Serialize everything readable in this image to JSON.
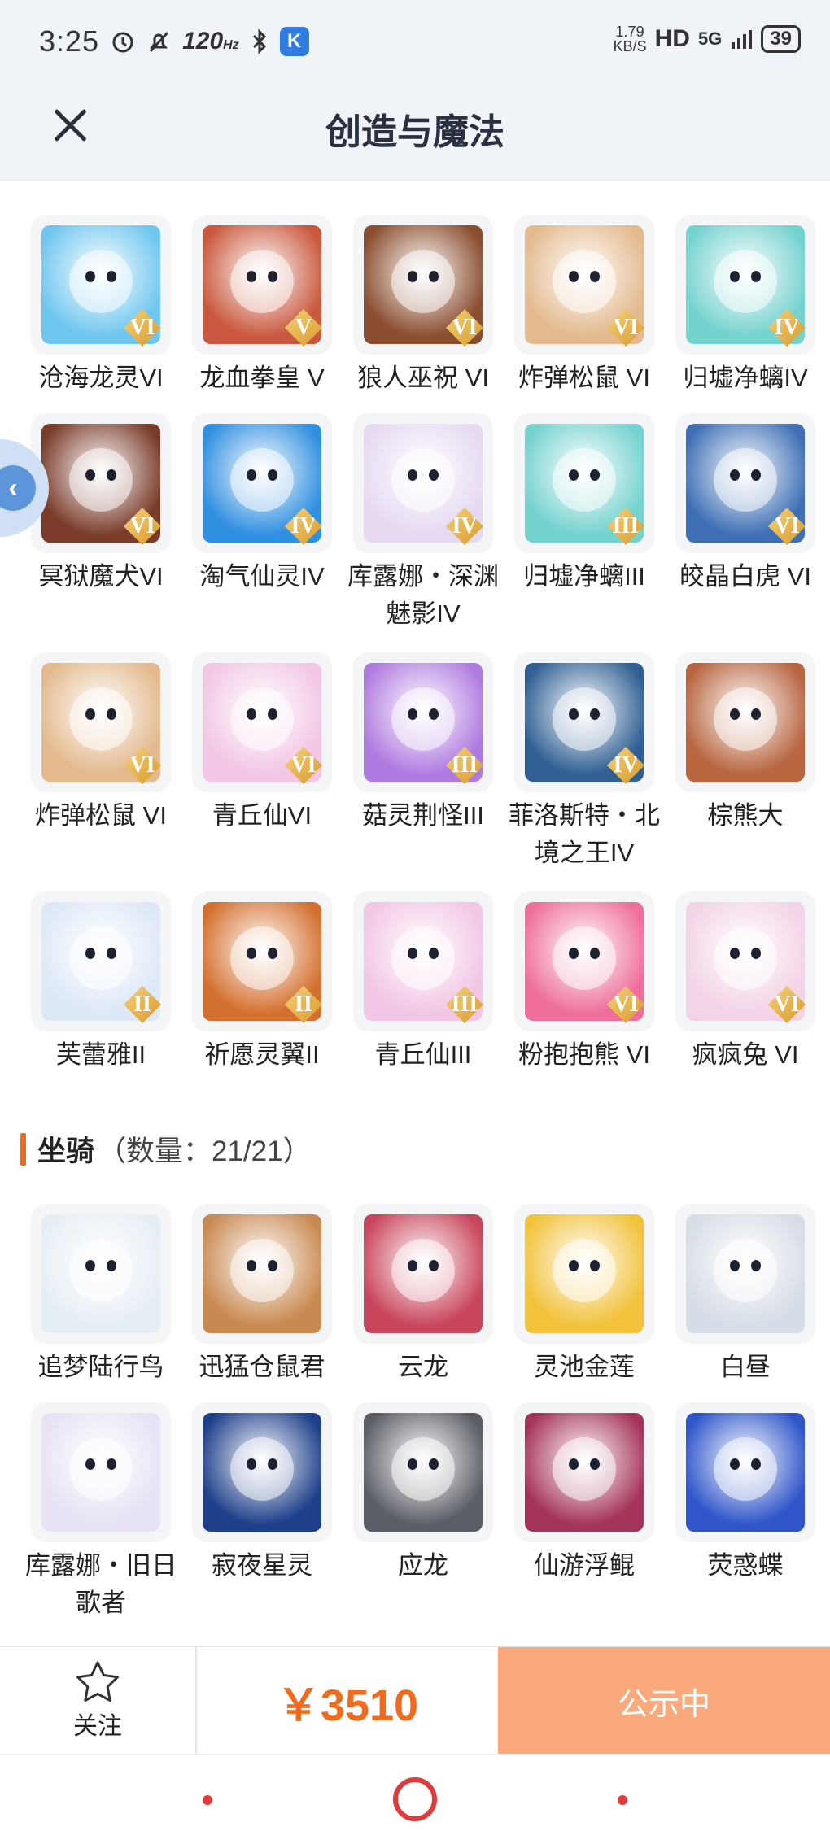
{
  "status_bar": {
    "time": "3:25",
    "refresh_rate": "120",
    "refresh_unit": "Hz",
    "app_badge": "K",
    "net_speed_value": "1.79",
    "net_speed_unit": "KB/S",
    "hd": "HD",
    "signal": "5G",
    "battery": "39"
  },
  "header": {
    "title": "创造与魔法"
  },
  "pets": [
    {
      "label": "沧海龙灵VI",
      "badge": "VI",
      "color": "#6fc6ef"
    },
    {
      "label": "龙血拳皇 V",
      "badge": "V",
      "color": "#c9583e"
    },
    {
      "label": "狼人巫祝 VI",
      "badge": "VI",
      "color": "#8a4d2f"
    },
    {
      "label": "炸弹松鼠 VI",
      "badge": "VI",
      "color": "#e3b98d"
    },
    {
      "label": "归墟净螭IV",
      "badge": "IV",
      "color": "#74d2cf"
    },
    {
      "label": "冥狱魔犬VI",
      "badge": "VI",
      "color": "#7a3b2a"
    },
    {
      "label": "淘气仙灵IV",
      "badge": "IV",
      "color": "#2f8fe0"
    },
    {
      "label": "库露娜・深渊魅影IV",
      "badge": "IV",
      "color": "#e6d9f2"
    },
    {
      "label": "归墟净螭III",
      "badge": "III",
      "color": "#74d2cf"
    },
    {
      "label": "皎晶白虎 VI",
      "badge": "VI",
      "color": "#3e6fb5"
    },
    {
      "label": "炸弹松鼠 VI",
      "badge": "VI",
      "color": "#e3b98d"
    },
    {
      "label": "青丘仙VI",
      "badge": "VI",
      "color": "#f2c6e4"
    },
    {
      "label": "菇灵荆怪III",
      "badge": "III",
      "color": "#b07be0"
    },
    {
      "label": "菲洛斯特・北境之王IV",
      "badge": "IV",
      "color": "#2f5f93"
    },
    {
      "label": "棕熊大",
      "badge": "",
      "color": "#b86540"
    },
    {
      "label": "芙蕾雅II",
      "badge": "II",
      "color": "#dde8f7"
    },
    {
      "label": "祈愿灵翼II",
      "badge": "II",
      "color": "#d4702f"
    },
    {
      "label": "青丘仙III",
      "badge": "III",
      "color": "#f2c6e4"
    },
    {
      "label": "粉抱抱熊 VI",
      "badge": "VI",
      "color": "#ee6f9b"
    },
    {
      "label": "疯疯兔 VI",
      "badge": "VI",
      "color": "#f3d3e6"
    }
  ],
  "mounts_section": {
    "title": "坐骑",
    "count": "（数量：21/21）"
  },
  "mounts": [
    {
      "label": "追梦陆行鸟",
      "badge": "",
      "color": "#e6eef5"
    },
    {
      "label": "迅猛仓鼠君",
      "badge": "",
      "color": "#c98a52"
    },
    {
      "label": "云龙",
      "badge": "",
      "color": "#c9455b"
    },
    {
      "label": "灵池金莲",
      "badge": "",
      "color": "#f2c23a"
    },
    {
      "label": "白昼",
      "badge": "",
      "color": "#d7dde6"
    },
    {
      "label": "库露娜・旧日歌者",
      "badge": "",
      "color": "#e7e2f4"
    },
    {
      "label": "寂夜星灵",
      "badge": "",
      "color": "#1e3f8a"
    },
    {
      "label": "应龙",
      "badge": "",
      "color": "#5b5e66"
    },
    {
      "label": "仙游浮鲲",
      "badge": "",
      "color": "#a5345c"
    },
    {
      "label": "荧惑蝶",
      "badge": "",
      "color": "#2f55c9"
    }
  ],
  "action_bar": {
    "follow_label": "关注",
    "price": "￥3510",
    "status_label": "公示中"
  },
  "icons": {
    "close": "close-icon",
    "star": "star-icon",
    "float": "collapse-icon"
  },
  "accent_color": "#f26b1d"
}
